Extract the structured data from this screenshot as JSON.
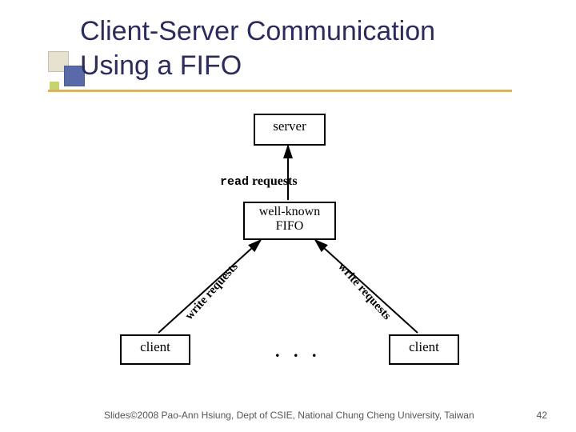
{
  "title": {
    "line1": "Client-Server Communication",
    "line2": "Using a FIFO"
  },
  "diagram": {
    "server_label": "server",
    "fifo_line1": "well-known",
    "fifo_line2": "FIFO",
    "client_label": "client",
    "read_word": "read",
    "requests_word": "requests",
    "write_requests": "write requests",
    "ellipsis": ". . ."
  },
  "footer": {
    "credit": "Slides©2008 Pao-Ann Hsiung, Dept of CSIE, National Chung Cheng University, Taiwan",
    "page": "42"
  }
}
